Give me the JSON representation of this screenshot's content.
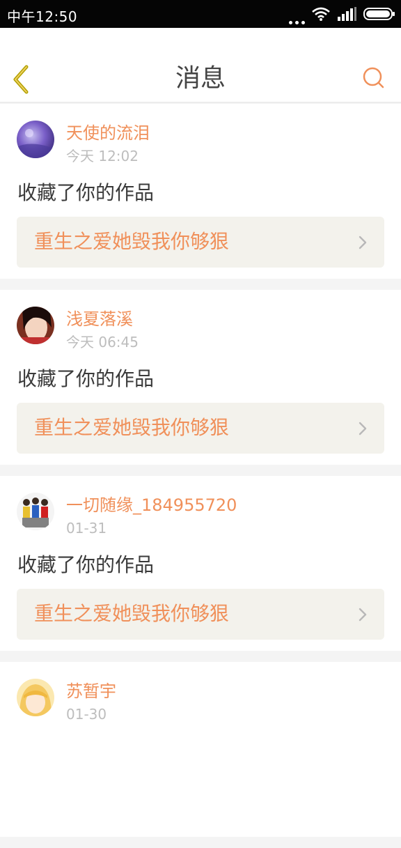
{
  "status_bar": {
    "time": "中午12:50",
    "icons": [
      "more-dots-icon",
      "wifi-icon",
      "signal-icon",
      "battery-icon"
    ]
  },
  "header": {
    "title": "消息",
    "back_icon": "chevron-left-icon",
    "search_icon": "search-icon"
  },
  "colors": {
    "accent": "#f0905a",
    "text": "#3a3a3a",
    "muted": "#bdbdbd",
    "card_link_bg": "#f3f2ec",
    "statusbar_bg": "#050505"
  },
  "messages": [
    {
      "user": "天使的流泪",
      "time": "今天 12:02",
      "action": "收藏了你的作品",
      "work": "重生之爱她毁我你够狠"
    },
    {
      "user": "浅夏落溪",
      "time": "今天 06:45",
      "action": "收藏了你的作品",
      "work": "重生之爱她毁我你够狠"
    },
    {
      "user": "一切随缘_184955720",
      "time": "01-31",
      "action": "收藏了你的作品",
      "work": "重生之爱她毁我你够狠"
    },
    {
      "user": "苏暂宇",
      "time": "01-30",
      "action": "",
      "work": ""
    }
  ]
}
